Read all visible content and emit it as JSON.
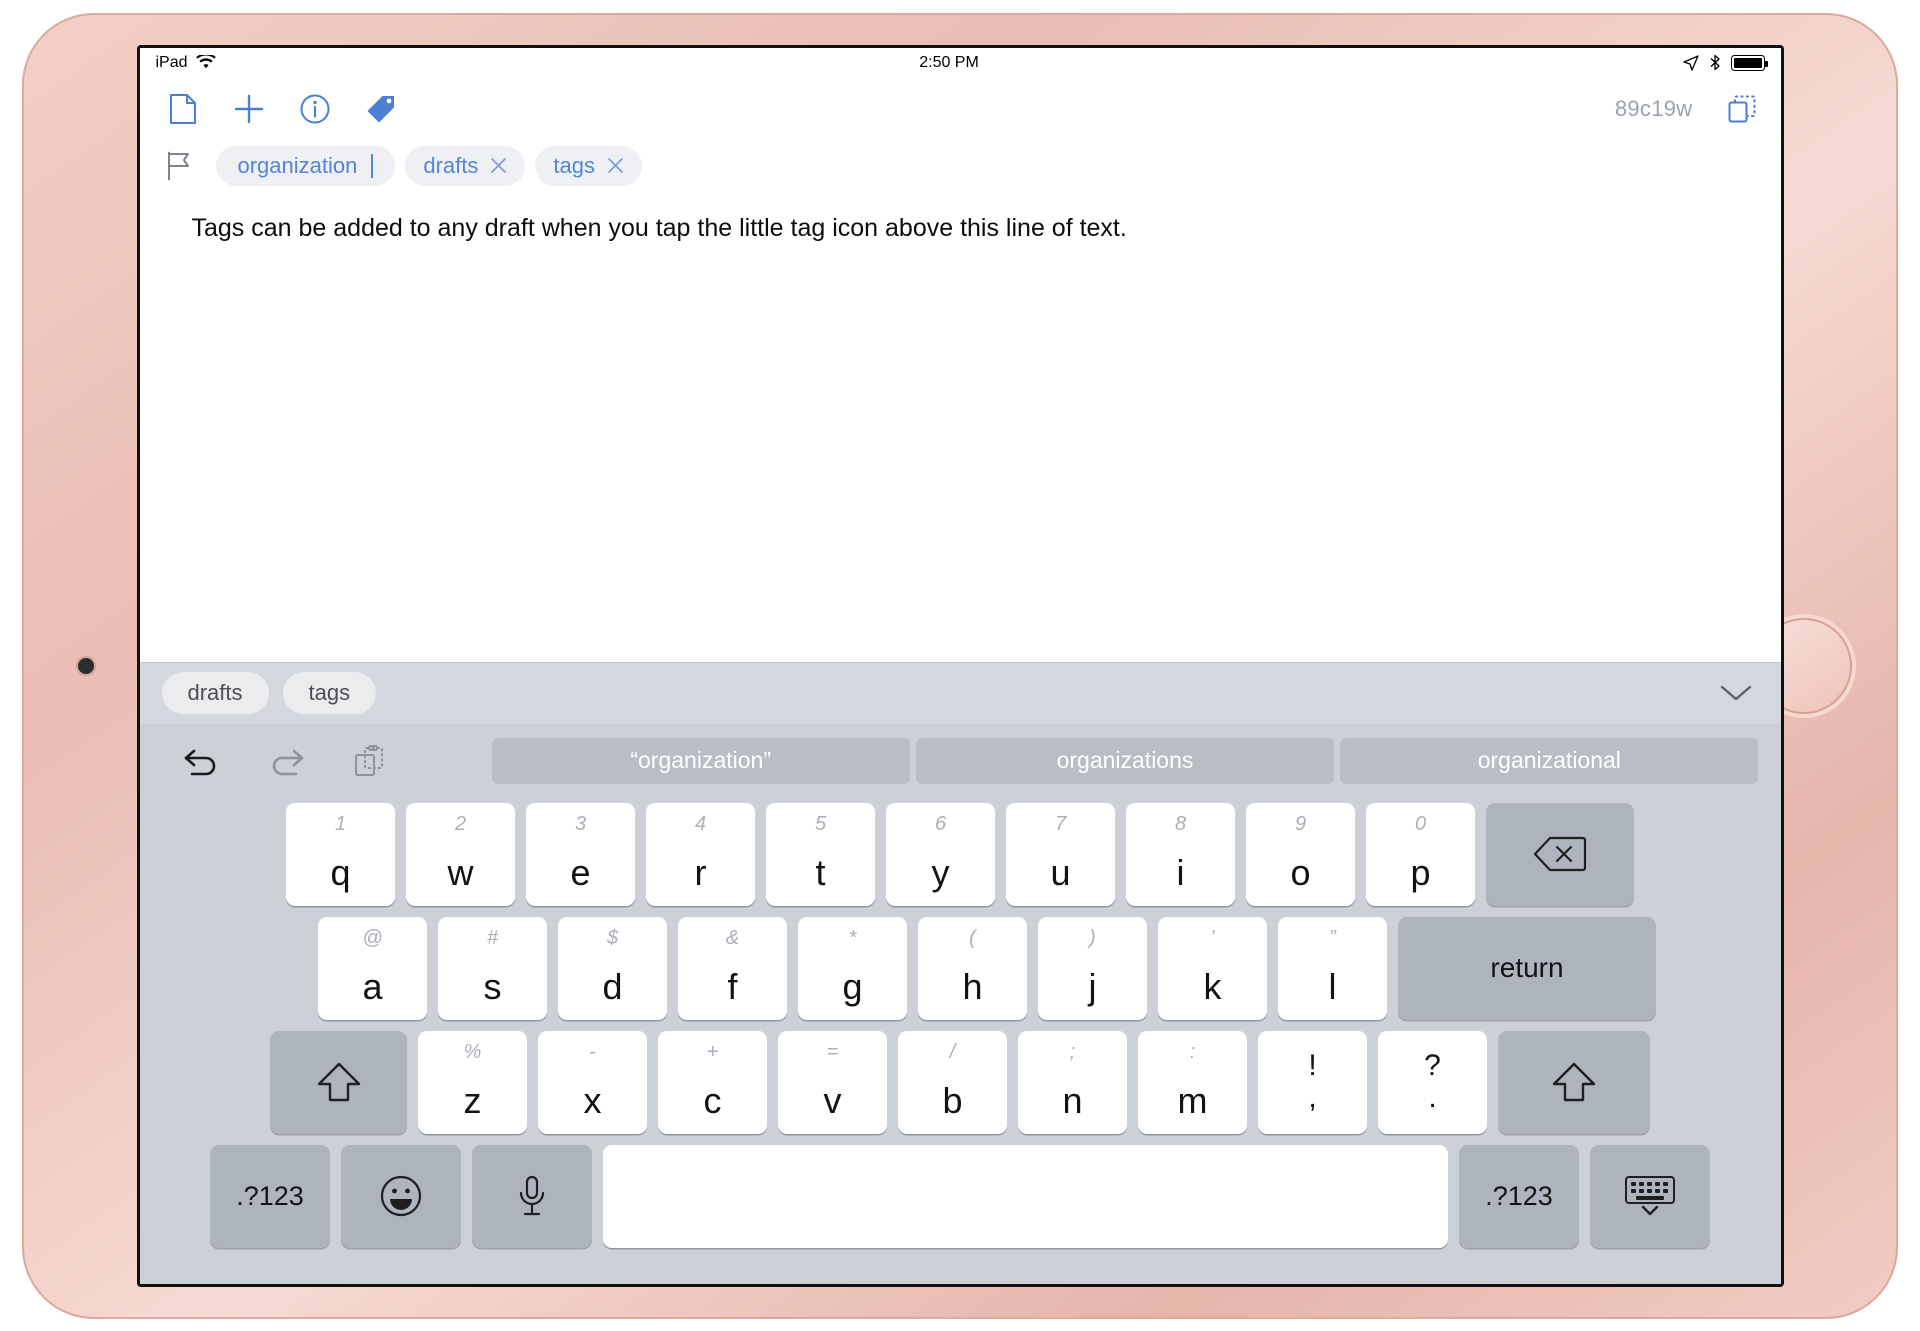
{
  "status_bar": {
    "device_label": "iPad",
    "wifi_icon": "wifi-icon",
    "time": "2:50 PM",
    "location_icon": "location-arrow-icon",
    "bluetooth_icon": "bluetooth-icon",
    "battery_icon": "battery-full-icon"
  },
  "toolbar": {
    "new_draft_icon": "document-icon",
    "add_icon": "plus-icon",
    "info_icon": "info-circle-icon",
    "tag_icon": "tag-icon",
    "draft_id": "89c19w",
    "duplicate_icon": "copy-icon"
  },
  "tag_bar": {
    "flag_icon": "flag-icon",
    "editing_tag": "organization",
    "tags": [
      {
        "label": "drafts",
        "remove_icon": "close-icon"
      },
      {
        "label": "tags",
        "remove_icon": "close-icon"
      }
    ]
  },
  "editor": {
    "body_text": "Tags can be added to any draft when you tap the little tag icon above this line of text."
  },
  "tag_suggestions": {
    "items": [
      "drafts",
      "tags"
    ],
    "dismiss_icon": "chevron-down-icon"
  },
  "keyboard": {
    "undo_icon": "undo-icon",
    "redo_icon": "redo-icon",
    "paste_icon": "clipboard-icon",
    "predictions": [
      "“organization”",
      "organizations",
      "organizational"
    ],
    "row1": [
      {
        "key": "q",
        "alt": "1"
      },
      {
        "key": "w",
        "alt": "2"
      },
      {
        "key": "e",
        "alt": "3"
      },
      {
        "key": "r",
        "alt": "4"
      },
      {
        "key": "t",
        "alt": "5"
      },
      {
        "key": "y",
        "alt": "6"
      },
      {
        "key": "u",
        "alt": "7"
      },
      {
        "key": "i",
        "alt": "8"
      },
      {
        "key": "o",
        "alt": "9"
      },
      {
        "key": "p",
        "alt": "0"
      }
    ],
    "backspace_icon": "backspace-icon",
    "row2": [
      {
        "key": "a",
        "alt": "@"
      },
      {
        "key": "s",
        "alt": "#"
      },
      {
        "key": "d",
        "alt": "$"
      },
      {
        "key": "f",
        "alt": "&"
      },
      {
        "key": "g",
        "alt": "*"
      },
      {
        "key": "h",
        "alt": "("
      },
      {
        "key": "j",
        "alt": ")"
      },
      {
        "key": "k",
        "alt": "’"
      },
      {
        "key": "l",
        "alt": "”"
      }
    ],
    "return_label": "return",
    "row3": [
      {
        "key": "z",
        "alt": "%"
      },
      {
        "key": "x",
        "alt": "-"
      },
      {
        "key": "c",
        "alt": "+"
      },
      {
        "key": "v",
        "alt": "="
      },
      {
        "key": "b",
        "alt": "/"
      },
      {
        "key": "n",
        "alt": ";"
      },
      {
        "key": "m",
        "alt": ":"
      }
    ],
    "punct_keys": [
      {
        "top": "!",
        "bot": ","
      },
      {
        "top": "?",
        "bot": "."
      }
    ],
    "shift_icon": "shift-up-icon",
    "shift_right_icon": "shift-up-icon",
    "numeric_left_label": ".?123",
    "numeric_right_label": ".?123",
    "emoji_icon": "smiley-face-icon",
    "mic_icon": "microphone-icon",
    "hide_keyboard_icon": "hide-keyboard-icon",
    "space_label": ""
  }
}
